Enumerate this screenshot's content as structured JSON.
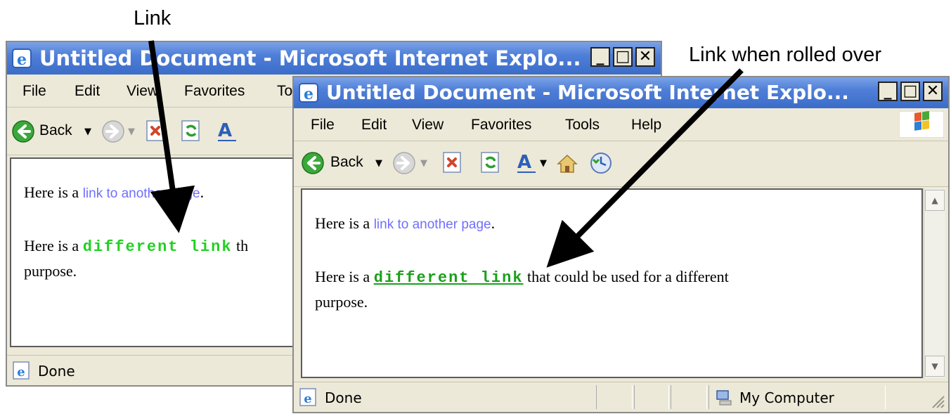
{
  "annotations": {
    "link_label": "Link",
    "rolled_label": "Link when rolled over"
  },
  "window": {
    "title": "Untitled Document - Microsoft Internet Explo...",
    "controls": {
      "minimize": "_",
      "maximize": "□",
      "close": "✕"
    },
    "menu": [
      "File",
      "Edit",
      "View",
      "Favorites",
      "Tools",
      "Help"
    ],
    "menu_back_visible": [
      "File",
      "Edit",
      "View",
      "Favorites",
      "To"
    ],
    "toolbar": {
      "back_label": "Back"
    },
    "page": {
      "p1_prefix": "Here is a ",
      "p1_link": "link to another page",
      "p1_suffix": ".",
      "p2_prefix": "Here is a ",
      "p2_link": "different link",
      "p2_suffix_front": " that could be used for a different",
      "p2_suffix_back": " th",
      "p2_line2": "purpose."
    },
    "status": {
      "text": "Done",
      "zone": "My Computer"
    }
  },
  "colors": {
    "link_normal": "#6f6fff",
    "link_special": "#22d022",
    "link_special_hover": "#1aa01a",
    "titlebar": "#3b6cc8"
  }
}
